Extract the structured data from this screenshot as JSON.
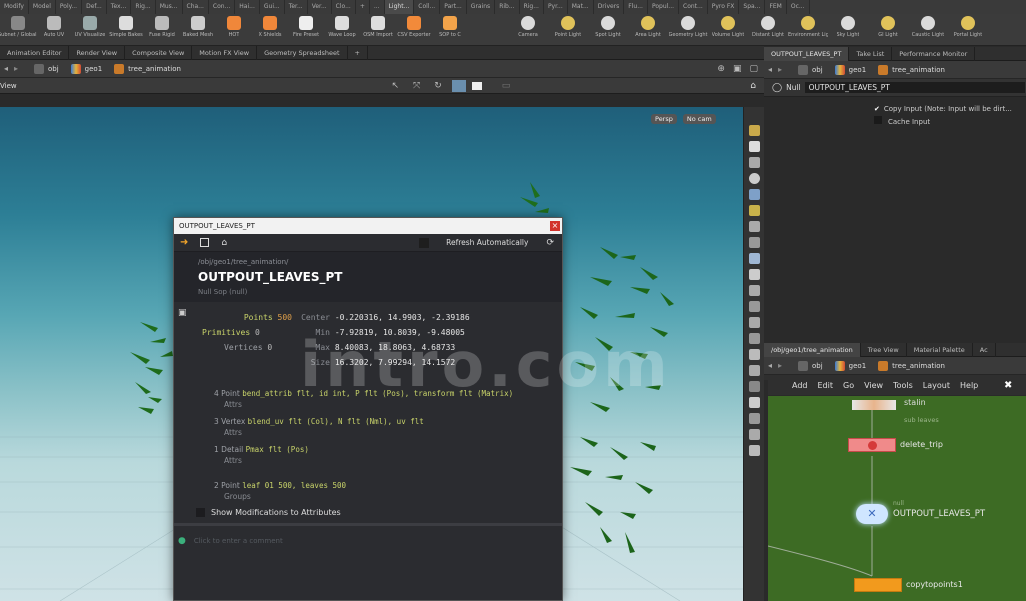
{
  "shelf": {
    "tabs": [
      "Modify",
      "Model",
      "Poly...",
      "Def...",
      "Tex...",
      "Rig...",
      "Mus...",
      "Cha...",
      "Con...",
      "Hai...",
      "Gui...",
      "Ter...",
      "Ver...",
      "Clo...",
      "+",
      "...",
      "Light...",
      "Coll...",
      "Part...",
      "Grains",
      "Rib...",
      "Rig...",
      "Pyr...",
      "Mat...",
      "Drivers",
      "Flu...",
      "Popul...",
      "Cont...",
      "Pyro FX",
      "Spa...",
      "FEM",
      "Oc..."
    ],
    "tools_left": [
      "Subnet / Global Subnet",
      "Auto UV",
      "UV Visualize",
      "Simple Bakes",
      "Fuse Rigid",
      "Baked Mesh",
      "HOT",
      "X Shields",
      "Fire Preset",
      "Wave Loop",
      "OSM Import",
      "CSV Exporter",
      "SOP to C"
    ],
    "tools_right": [
      "Camera",
      "Point Light",
      "Spot Light",
      "Area Light",
      "Geometry Light",
      "Volume Light",
      "Distant Light",
      "Environment Light",
      "Sky Light",
      "GI Light",
      "Caustic Light",
      "Portal Light"
    ]
  },
  "left_pane": {
    "tabs": [
      "Animation Editor",
      "Render View",
      "Composite View",
      "Motion FX View",
      "Geometry Spreadsheet",
      "+"
    ],
    "path": [
      "obj",
      "geo1",
      "tree_animation"
    ],
    "view_label": "View",
    "viewport_buttons": [
      "Persp",
      "No cam"
    ]
  },
  "dialog": {
    "title": "OUTPOUT_LEAVES_PT",
    "refresh_label": "Refresh Automatically",
    "node_path": "/obj/geo1/tree_animation/",
    "node_name": "OUTPOUT_LEAVES_PT",
    "node_type": "Null Sop (null)",
    "stats": [
      {
        "label": "Points",
        "value": "500"
      },
      {
        "label": "Primitives",
        "value": "0"
      },
      {
        "label": "Vertices",
        "value": "0"
      }
    ],
    "bbox": [
      {
        "label": "Center",
        "values": "-0.220316, 14.9903, -2.39186"
      },
      {
        "label": "Min",
        "values": "-7.92819, 10.8039, -9.48005"
      },
      {
        "label": "Max",
        "values": "8.40083, 18.8063, 4.68733"
      },
      {
        "label": "Size",
        "values": "16.3202, 7.99294, 14.1572"
      }
    ],
    "attr_groups": [
      {
        "count": "4",
        "kind": "Point",
        "attrs": "bend_attrib flt, id int, P flt (Pos), transform flt (Matrix)",
        "label": "Attrs"
      },
      {
        "count": "3",
        "kind": "Vertex",
        "attrs": "blend_uv flt (Col), N flt (Nml), uv flt",
        "label": "Attrs"
      },
      {
        "count": "1",
        "kind": "Detail",
        "attrs": "Pmax flt (Pos)",
        "label": "Attrs"
      },
      {
        "count": "2",
        "kind": "Point",
        "attrs": "leaf 01 500, leaves 500",
        "label": "Groups"
      }
    ],
    "show_mods_label": "Show Modifications to Attributes",
    "comment_placeholder": "Click to enter a comment"
  },
  "right_pane": {
    "tabs": [
      "OUTPOUT_LEAVES_PT",
      "Take List",
      "Performance Monitor"
    ],
    "path": [
      "obj",
      "geo1",
      "tree_animation"
    ],
    "node_type": "Null",
    "node_name": "OUTPOUT_LEAVES_PT",
    "param_copy_input": "Copy Input (Note: Input will be dirt...",
    "param_cache_input": "Cache Input"
  },
  "network": {
    "tabs": [
      "/obj/geo1/tree_animation",
      "Tree View",
      "Material Palette",
      "Ac"
    ],
    "path": [
      "obj",
      "geo1",
      "tree_animation"
    ],
    "menu": [
      "Add",
      "Edit",
      "Go",
      "View",
      "Tools",
      "Layout",
      "Help"
    ],
    "nodes": [
      {
        "name": "stalin",
        "sub": "sub leaves"
      },
      {
        "name": "delete_trip"
      },
      {
        "name": "OUTPOUT_LEAVES_PT",
        "sub": "null"
      },
      {
        "name": "copytopoints1"
      }
    ]
  },
  "watermark": "intro.com",
  "colors": {
    "accent": "#f29a1d",
    "network_bg": "#3d6b24",
    "close_red": "#d2332c"
  }
}
